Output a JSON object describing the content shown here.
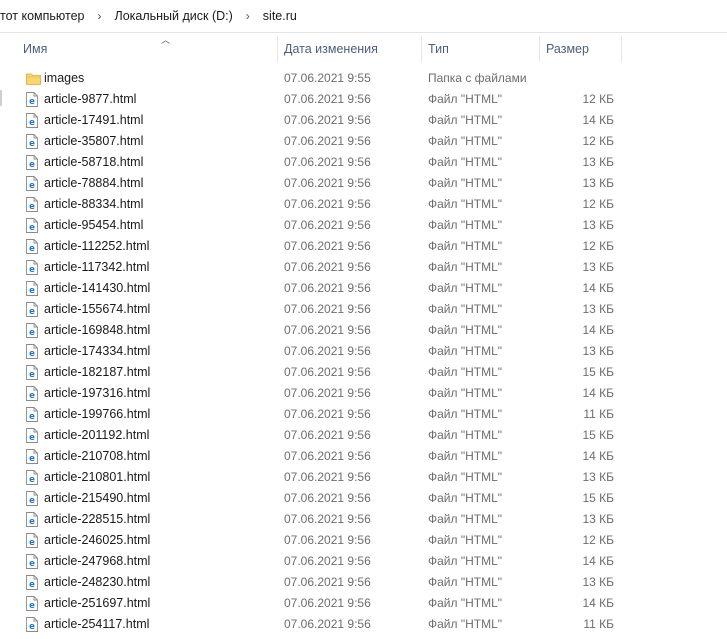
{
  "breadcrumb": [
    "тот компьютер",
    "Локальный диск (D:)",
    "site.ru"
  ],
  "columns": {
    "name": "Имя",
    "date": "Дата изменения",
    "type": "Тип",
    "size": "Размер"
  },
  "colors": {
    "folder": "#f8d674",
    "html_icon": "#1f78d1",
    "header_text": "#4c607a"
  },
  "files": [
    {
      "name": "images",
      "date": "07.06.2021 9:55",
      "type": "Папка с файлами",
      "size": "",
      "icon": "folder-icon"
    },
    {
      "name": "article-9877.html",
      "date": "07.06.2021 9:56",
      "type": "Файл \"HTML\"",
      "size": "12 КБ",
      "icon": "html-file-icon"
    },
    {
      "name": "article-17491.html",
      "date": "07.06.2021 9:56",
      "type": "Файл \"HTML\"",
      "size": "14 КБ",
      "icon": "html-file-icon"
    },
    {
      "name": "article-35807.html",
      "date": "07.06.2021 9:56",
      "type": "Файл \"HTML\"",
      "size": "12 КБ",
      "icon": "html-file-icon"
    },
    {
      "name": "article-58718.html",
      "date": "07.06.2021 9:56",
      "type": "Файл \"HTML\"",
      "size": "13 КБ",
      "icon": "html-file-icon"
    },
    {
      "name": "article-78884.html",
      "date": "07.06.2021 9:56",
      "type": "Файл \"HTML\"",
      "size": "13 КБ",
      "icon": "html-file-icon"
    },
    {
      "name": "article-88334.html",
      "date": "07.06.2021 9:56",
      "type": "Файл \"HTML\"",
      "size": "12 КБ",
      "icon": "html-file-icon"
    },
    {
      "name": "article-95454.html",
      "date": "07.06.2021 9:56",
      "type": "Файл \"HTML\"",
      "size": "13 КБ",
      "icon": "html-file-icon"
    },
    {
      "name": "article-112252.html",
      "date": "07.06.2021 9:56",
      "type": "Файл \"HTML\"",
      "size": "12 КБ",
      "icon": "html-file-icon"
    },
    {
      "name": "article-117342.html",
      "date": "07.06.2021 9:56",
      "type": "Файл \"HTML\"",
      "size": "13 КБ",
      "icon": "html-file-icon"
    },
    {
      "name": "article-141430.html",
      "date": "07.06.2021 9:56",
      "type": "Файл \"HTML\"",
      "size": "14 КБ",
      "icon": "html-file-icon"
    },
    {
      "name": "article-155674.html",
      "date": "07.06.2021 9:56",
      "type": "Файл \"HTML\"",
      "size": "13 КБ",
      "icon": "html-file-icon"
    },
    {
      "name": "article-169848.html",
      "date": "07.06.2021 9:56",
      "type": "Файл \"HTML\"",
      "size": "14 КБ",
      "icon": "html-file-icon"
    },
    {
      "name": "article-174334.html",
      "date": "07.06.2021 9:56",
      "type": "Файл \"HTML\"",
      "size": "13 КБ",
      "icon": "html-file-icon"
    },
    {
      "name": "article-182187.html",
      "date": "07.06.2021 9:56",
      "type": "Файл \"HTML\"",
      "size": "15 КБ",
      "icon": "html-file-icon"
    },
    {
      "name": "article-197316.html",
      "date": "07.06.2021 9:56",
      "type": "Файл \"HTML\"",
      "size": "14 КБ",
      "icon": "html-file-icon"
    },
    {
      "name": "article-199766.html",
      "date": "07.06.2021 9:56",
      "type": "Файл \"HTML\"",
      "size": "11 КБ",
      "icon": "html-file-icon"
    },
    {
      "name": "article-201192.html",
      "date": "07.06.2021 9:56",
      "type": "Файл \"HTML\"",
      "size": "15 КБ",
      "icon": "html-file-icon"
    },
    {
      "name": "article-210708.html",
      "date": "07.06.2021 9:56",
      "type": "Файл \"HTML\"",
      "size": "14 КБ",
      "icon": "html-file-icon"
    },
    {
      "name": "article-210801.html",
      "date": "07.06.2021 9:56",
      "type": "Файл \"HTML\"",
      "size": "13 КБ",
      "icon": "html-file-icon"
    },
    {
      "name": "article-215490.html",
      "date": "07.06.2021 9:56",
      "type": "Файл \"HTML\"",
      "size": "15 КБ",
      "icon": "html-file-icon"
    },
    {
      "name": "article-228515.html",
      "date": "07.06.2021 9:56",
      "type": "Файл \"HTML\"",
      "size": "13 КБ",
      "icon": "html-file-icon"
    },
    {
      "name": "article-246025.html",
      "date": "07.06.2021 9:56",
      "type": "Файл \"HTML\"",
      "size": "12 КБ",
      "icon": "html-file-icon"
    },
    {
      "name": "article-247968.html",
      "date": "07.06.2021 9:56",
      "type": "Файл \"HTML\"",
      "size": "14 КБ",
      "icon": "html-file-icon"
    },
    {
      "name": "article-248230.html",
      "date": "07.06.2021 9:56",
      "type": "Файл \"HTML\"",
      "size": "13 КБ",
      "icon": "html-file-icon"
    },
    {
      "name": "article-251697.html",
      "date": "07.06.2021 9:56",
      "type": "Файл \"HTML\"",
      "size": "14 КБ",
      "icon": "html-file-icon"
    },
    {
      "name": "article-254117.html",
      "date": "07.06.2021 9:56",
      "type": "Файл \"HTML\"",
      "size": "11 КБ",
      "icon": "html-file-icon"
    }
  ]
}
